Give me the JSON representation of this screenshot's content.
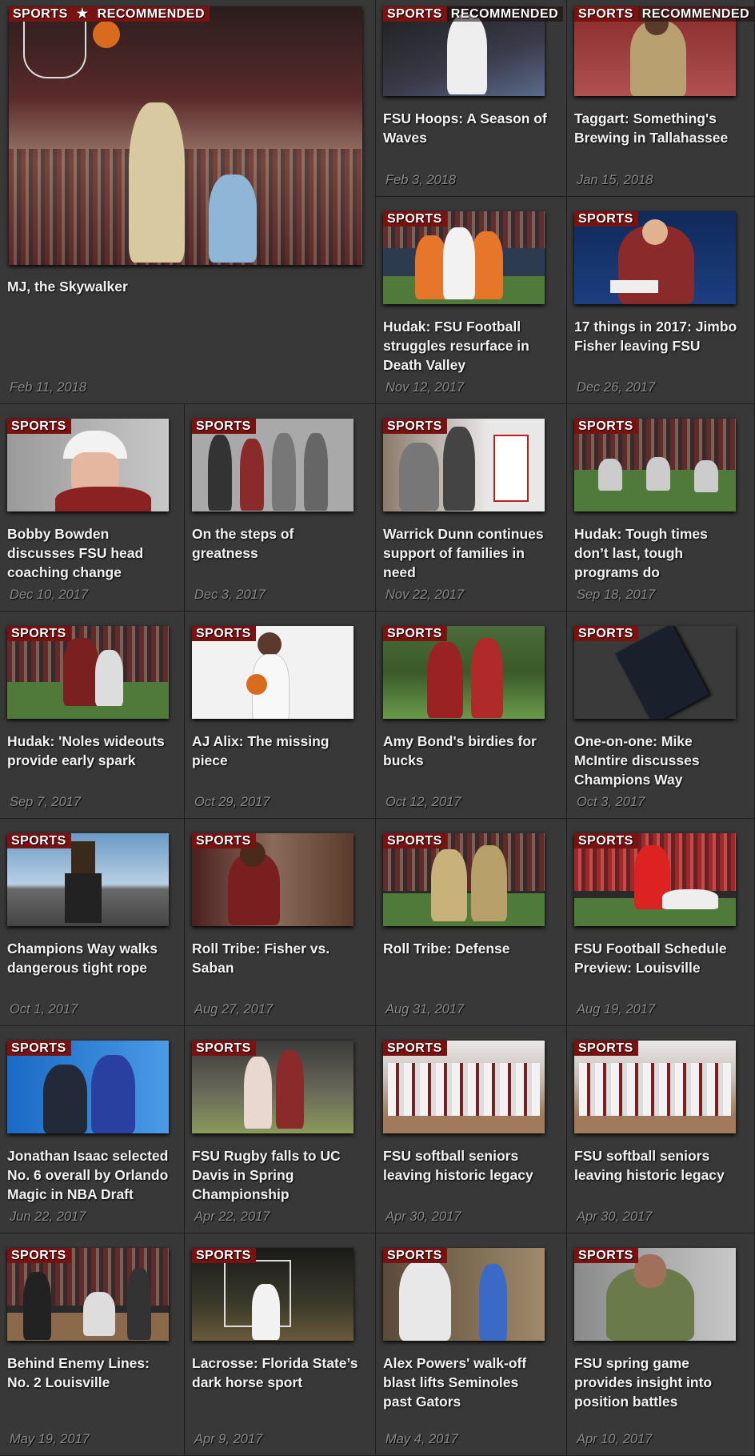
{
  "feature": {
    "tag": "SPORTS",
    "star": "★",
    "rec": "RECOMMENDED",
    "title": "MJ, the Skywalker",
    "date": "Feb 11, 2018"
  },
  "cards": [
    {
      "tag": "SPORTS",
      "rec": "RECOMMENDED",
      "title": "FSU Hoops: A Season of Waves",
      "date": "Feb 3, 2018"
    },
    {
      "tag": "SPORTS",
      "rec": "RECOMMENDED",
      "title": "Taggart: Something's Brewing in Tallahassee",
      "date": "Jan 15, 2018"
    },
    {
      "tag": "SPORTS",
      "title": "Hudak: FSU Football struggles resurface in Death Valley",
      "date": "Nov 12, 2017"
    },
    {
      "tag": "SPORTS",
      "title": "17 things in 2017: Jimbo Fisher leaving FSU",
      "date": "Dec 26, 2017"
    },
    {
      "tag": "SPORTS",
      "title": "Bobby Bowden discusses FSU head coaching change",
      "date": "Dec 10, 2017"
    },
    {
      "tag": "SPORTS",
      "title": "On the steps of greatness",
      "date": "Dec 3, 2017"
    },
    {
      "tag": "SPORTS",
      "title": "Warrick Dunn continues support of families in need",
      "date": "Nov 22, 2017"
    },
    {
      "tag": "SPORTS",
      "title": "Hudak: Tough times don’t last, tough programs do",
      "date": "Sep 18, 2017"
    },
    {
      "tag": "SPORTS",
      "title": "Hudak: 'Noles wideouts provide early spark",
      "date": "Sep 7, 2017"
    },
    {
      "tag": "SPORTS",
      "title": "AJ Alix: The missing piece",
      "date": "Oct 29, 2017"
    },
    {
      "tag": "SPORTS",
      "title": "Amy Bond's birdies for bucks",
      "date": "Oct 12, 2017"
    },
    {
      "tag": "SPORTS",
      "title": "One-on-one: Mike McIntire discusses Champions Way",
      "date": "Oct 3, 2017"
    },
    {
      "tag": "SPORTS",
      "title": "Champions Way walks dangerous tight rope",
      "date": "Oct 1, 2017"
    },
    {
      "tag": "SPORTS",
      "title": "Roll Tribe: Fisher vs. Saban",
      "date": "Aug 27, 2017"
    },
    {
      "tag": "SPORTS",
      "title": "Roll Tribe: Defense",
      "date": "Aug 31, 2017"
    },
    {
      "tag": "SPORTS",
      "title": "FSU Football Schedule Preview: Louisville",
      "date": "Aug 19, 2017"
    },
    {
      "tag": "SPORTS",
      "title": "Jonathan Isaac selected No. 6 overall by Orlando Magic in NBA Draft",
      "date": "Jun 22, 2017"
    },
    {
      "tag": "SPORTS",
      "title": "FSU Rugby falls to UC Davis in Spring Championship",
      "date": "Apr 22, 2017"
    },
    {
      "tag": "SPORTS",
      "title": "FSU softball seniors leaving historic legacy",
      "date": "Apr 30, 2017"
    },
    {
      "tag": "SPORTS",
      "title": "FSU softball seniors leaving historic legacy",
      "date": "Apr 30, 2017"
    },
    {
      "tag": "SPORTS",
      "title": "Behind Enemy Lines: No. 2 Louisville",
      "date": "May 19, 2017"
    },
    {
      "tag": "SPORTS",
      "title": "Lacrosse: Florida State’s dark horse sport",
      "date": "Apr 9, 2017"
    },
    {
      "tag": "SPORTS",
      "title": "Alex Powers' walk-off blast lifts Seminoles past Gators",
      "date": "May 4, 2017"
    },
    {
      "tag": "SPORTS",
      "title": "FSU spring game provides insight into position battles",
      "date": "Apr 10, 2017"
    }
  ]
}
